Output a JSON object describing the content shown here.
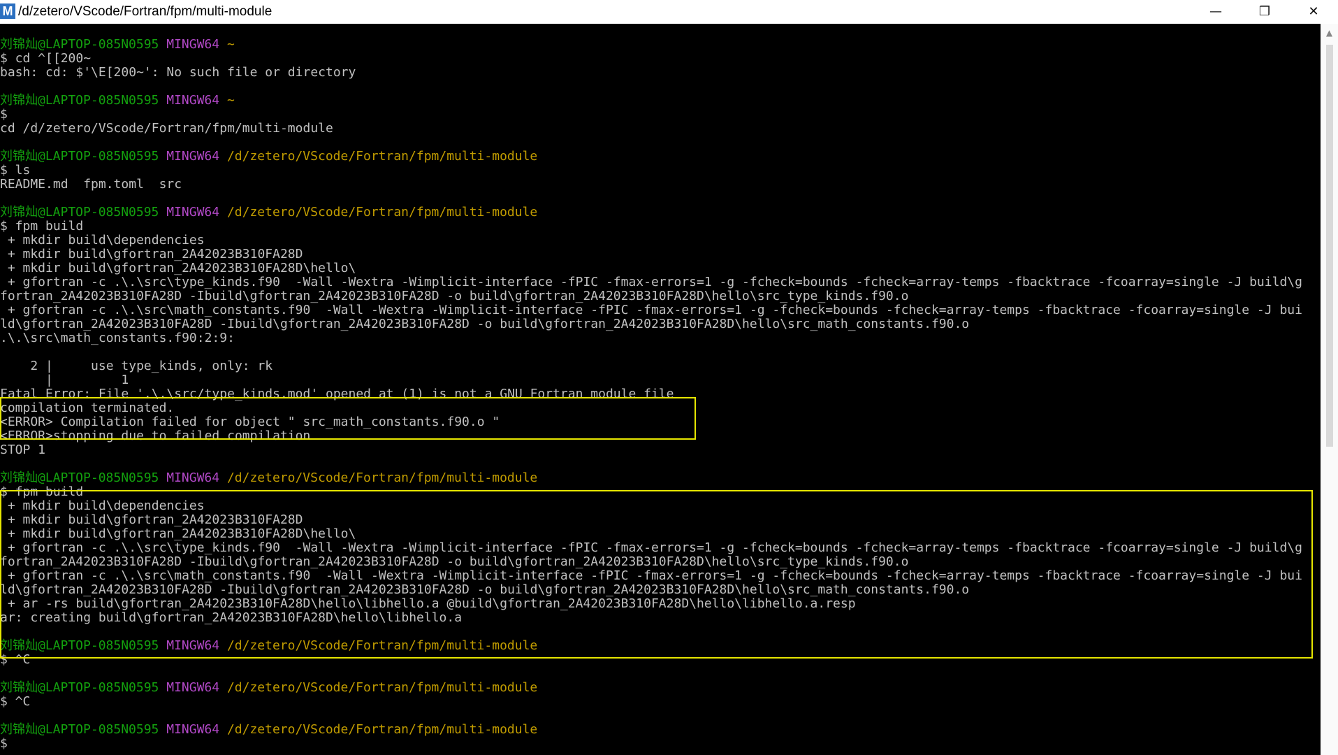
{
  "window": {
    "icon_letter": "M",
    "title": "/d/zetero/VScode/Fortran/fpm/multi-module",
    "minimize_glyph": "—",
    "maximize_glyph": "❐",
    "close_glyph": "✕"
  },
  "terminal": {
    "prompt": {
      "user": "刘锦灿@LAPTOP-085N0595",
      "shell": "MINGW64",
      "home_path": "~",
      "project_path": "/d/zetero/VScode/Fortran/fpm/multi-module"
    },
    "lines": {
      "l02": "$ cd ^[[200~",
      "l03": "bash: cd: $'\\E[200~': No such file or directory",
      "l06": "$",
      "l07": "cd /d/zetero/VScode/Fortran/fpm/multi-module",
      "l10": "$ ls",
      "l11": "README.md  fpm.toml  src",
      "l14": "$ fpm build",
      "l15": " + mkdir build\\dependencies",
      "l16": " + mkdir build\\gfortran_2A42023B310FA28D",
      "l17": " + mkdir build\\gfortran_2A42023B310FA28D\\hello\\",
      "l18": " + gfortran -c .\\.\\src\\type_kinds.f90  -Wall -Wextra -Wimplicit-interface -fPIC -fmax-errors=1 -g -fcheck=bounds -fcheck=array-temps -fbacktrace -fcoarray=single -J build\\g",
      "l19": "fortran_2A42023B310FA28D -Ibuild\\gfortran_2A42023B310FA28D -o build\\gfortran_2A42023B310FA28D\\hello\\src_type_kinds.f90.o",
      "l20": " + gfortran -c .\\.\\src\\math_constants.f90  -Wall -Wextra -Wimplicit-interface -fPIC -fmax-errors=1 -g -fcheck=bounds -fcheck=array-temps -fbacktrace -fcoarray=single -J bui",
      "l21": "ld\\gfortran_2A42023B310FA28D -Ibuild\\gfortran_2A42023B310FA28D -o build\\gfortran_2A42023B310FA28D\\hello\\src_math_constants.f90.o",
      "l22": ".\\.\\src\\math_constants.f90:2:9:",
      "l24": "    2 |     use type_kinds, only: rk",
      "l25": "      |         1",
      "l26": "Fatal Error: File '.\\.\\src/type_kinds.mod' opened at (1) is not a GNU Fortran module file",
      "l27": "compilation terminated.",
      "l28": "<ERROR> Compilation failed for object \" src_math_constants.f90.o \"",
      "l29": "<ERROR>stopping due to failed compilation",
      "l30": "STOP 1",
      "l33": "$ fpm build",
      "l34": " + mkdir build\\dependencies",
      "l35": " + mkdir build\\gfortran_2A42023B310FA28D",
      "l36": " + mkdir build\\gfortran_2A42023B310FA28D\\hello\\",
      "l37": " + gfortran -c .\\.\\src\\type_kinds.f90  -Wall -Wextra -Wimplicit-interface -fPIC -fmax-errors=1 -g -fcheck=bounds -fcheck=array-temps -fbacktrace -fcoarray=single -J build\\g",
      "l38": "fortran_2A42023B310FA28D -Ibuild\\gfortran_2A42023B310FA28D -o build\\gfortran_2A42023B310FA28D\\hello\\src_type_kinds.f90.o",
      "l39": " + gfortran -c .\\.\\src\\math_constants.f90  -Wall -Wextra -Wimplicit-interface -fPIC -fmax-errors=1 -g -fcheck=bounds -fcheck=array-temps -fbacktrace -fcoarray=single -J bui",
      "l40": "ld\\gfortran_2A42023B310FA28D -Ibuild\\gfortran_2A42023B310FA28D -o build\\gfortran_2A42023B310FA28D\\hello\\src_math_constants.f90.o",
      "l41": " + ar -rs build\\gfortran_2A42023B310FA28D\\hello\\libhello.a @build\\gfortran_2A42023B310FA28D\\hello\\libhello.a.resp",
      "l42": "ar: creating build\\gfortran_2A42023B310FA28D\\hello\\libhello.a",
      "l45": "$ ^C",
      "l48": "$ ^C",
      "l51": "$"
    }
  },
  "scrollbar": {
    "up_arrow_glyph": "▲"
  },
  "colors": {
    "background": "#000000",
    "text": "#c0c0c0",
    "user": "#13a10e",
    "shell": "#b148c6",
    "path": "#c19c00",
    "highlight_box": "#e6e600"
  }
}
